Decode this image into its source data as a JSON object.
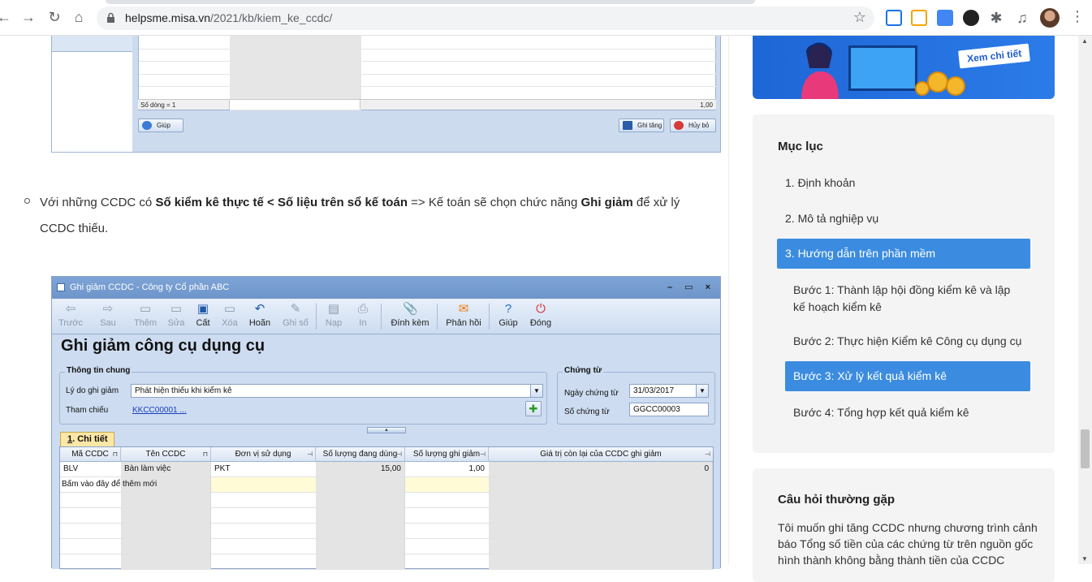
{
  "browser": {
    "url_host": "helpsme.misa.vn",
    "url_path": "/2021/kb/kiem_ke_ccdc/"
  },
  "top_shot": {
    "row_count_label": "Số dòng = 1",
    "total_value": "1,00",
    "help_button": "Giúp",
    "save_button": "Ghi tăng",
    "cancel_button": "Hủy bỏ"
  },
  "article": {
    "p_prefix": "Với những CCDC có ",
    "p_bold1": "Số kiểm kê thực tế < Số liệu trên sổ kế toán",
    "p_mid": " => Kế toán sẽ chọn chức năng ",
    "p_bold2": "Ghi giảm",
    "p_suffix": " để xử lý CCDC thiếu."
  },
  "app": {
    "window_title": "Ghi giảm CCDC - Công ty Cổ phần ABC",
    "window_buttons": "– ▭ ×",
    "toolbar": {
      "prev": "Trước",
      "next": "Sau",
      "add": "Thêm",
      "edit": "Sửa",
      "save": "Cất",
      "delete": "Xóa",
      "undo": "Hoãn",
      "post": "Ghi sổ",
      "load": "Nạp",
      "print": "In",
      "attach": "Đính kèm",
      "feedback": "Phản hồi",
      "help": "Giúp",
      "close": "Đóng"
    },
    "heading": "Ghi giảm công cụ dụng cụ",
    "general": {
      "legend": "Thông tin chung",
      "reason_label": "Lý do ghi giảm",
      "reason_value": "Phát hiện thiếu khi kiểm kê",
      "ref_label": "Tham chiếu",
      "ref_value": "KKCC00001 ..."
    },
    "voucher": {
      "legend": "Chứng từ",
      "date_label": "Ngày chứng từ",
      "date_value": "31/03/2017",
      "no_label": "Số chứng từ",
      "no_value": "GGCC00003"
    },
    "tab": {
      "num": "1",
      "label": ". Chi tiết"
    },
    "grid": {
      "headers": [
        "Mã CCDC",
        "Tên CCDC",
        "Đơn vị sử dụng",
        "Số lượng đang dùng",
        "Số lượng ghi giảm",
        "Giá trị còn lại của CCDC ghi giảm"
      ],
      "row1": [
        "BLV",
        "Bàn làm việc",
        "PKT",
        "15,00",
        "1,00",
        "0"
      ],
      "new_row_hint": "Bấm vào đây để thêm mới"
    }
  },
  "sidebar": {
    "promo_button": "Xem chi tiết",
    "toc_title": "Mục lục",
    "toc": [
      "1. Định khoản",
      "2. Mô tả nghiệp vụ",
      "3. Hướng dẫn trên phần mềm",
      "Bước 1: Thành lập hội đồng kiểm kê và lập kế hoạch kiểm kê",
      "Bước 2: Thực hiện Kiểm kê Công cụ dụng cụ",
      "Bước 3: Xử lý kết quả kiểm kê",
      "Bước 4: Tổng hợp kết quả kiểm kê"
    ],
    "faq_title": "Câu hỏi thường gặp",
    "faq_text": "Tôi muốn ghi tăng CCDC nhưng chương trình cảnh báo Tổng số tiền của các chứng từ trên nguồn gốc hình thành không bằng thành tiền của CCDC"
  }
}
